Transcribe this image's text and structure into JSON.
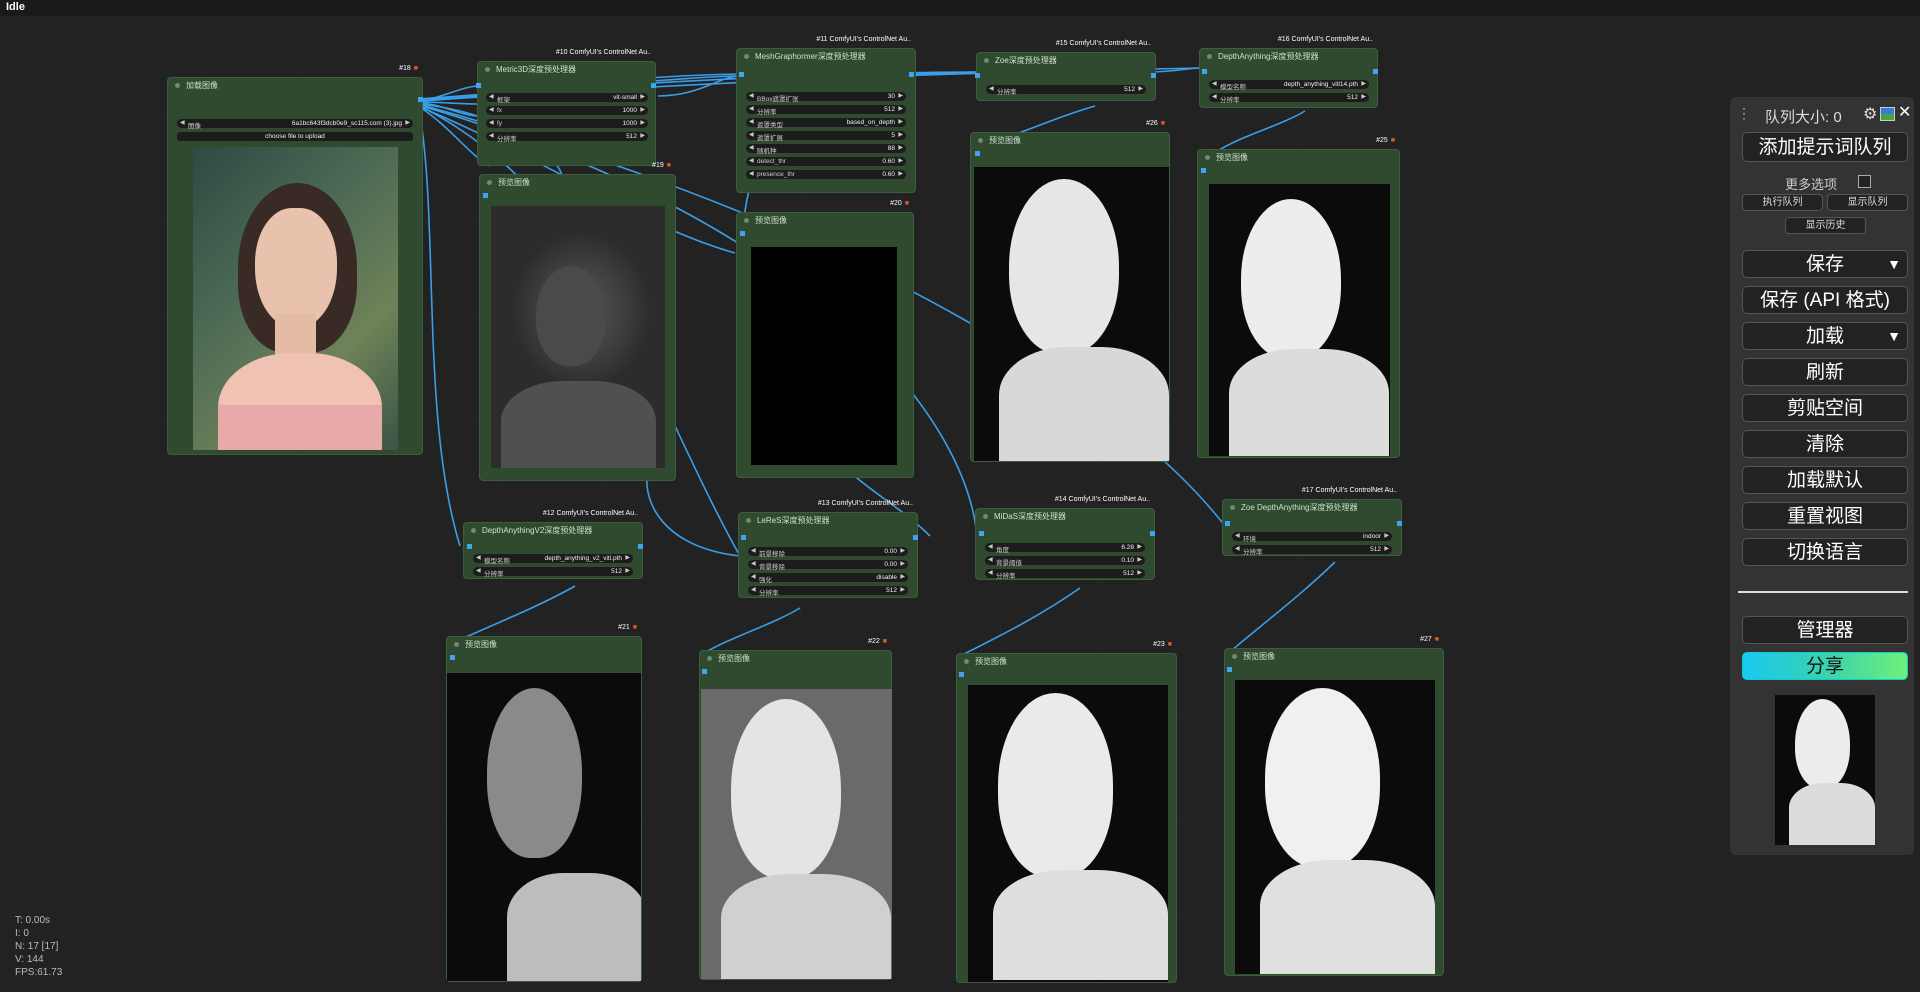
{
  "status": "Idle",
  "queue": {
    "title": "队列大小: 0",
    "add_prompt": "添加提示词队列",
    "more_options": "更多选项",
    "run_queue": "执行队列",
    "show_queue": "显示队列",
    "show_history": "显示历史",
    "save": "保存",
    "save_api": "保存 (API 格式)",
    "load": "加载",
    "refresh": "刷新",
    "clipspace": "剪贴空间",
    "clear": "清除",
    "load_default": "加载默认",
    "reset_view": "重置视图",
    "switch_lang": "切换语言",
    "manager": "管理器",
    "share": "分享"
  },
  "stats": [
    "T: 0.00s",
    "I: 0",
    "N: 17 [17]",
    "V: 144",
    "FPS:61.73"
  ],
  "nodes": {
    "n18": {
      "badge": "#18",
      "title": "加载图像",
      "image_label": "图像",
      "image_value": "6a1bc643f3dcb0e9_sc115.com (3).jpg",
      "upload": "choose file to upload"
    },
    "n10": {
      "badge": "#10 ComfyUI's ControlNet Au..",
      "title": "Metric3D深度预处理器",
      "widgets": [
        {
          "label": "框架",
          "value": "vit-small"
        },
        {
          "label": "fx",
          "value": "1000"
        },
        {
          "label": "fy",
          "value": "1000"
        },
        {
          "label": "分辨率",
          "value": "512"
        }
      ]
    },
    "n11": {
      "badge": "#11 ComfyUI's ControlNet Au..",
      "title": "MeshGraphormer深度预处理器",
      "widgets": [
        {
          "label": "BBox遮罩扩张",
          "value": "30"
        },
        {
          "label": "分辨率",
          "value": "512"
        },
        {
          "label": "遮罩类型",
          "value": "based_on_depth"
        },
        {
          "label": "遮罩扩展",
          "value": "5"
        },
        {
          "label": "随机种",
          "value": "88"
        },
        {
          "label": "detect_thr",
          "value": "0.60"
        },
        {
          "label": "presence_thr",
          "value": "0.60"
        }
      ]
    },
    "n15": {
      "badge": "#15 ComfyUI's ControlNet Au..",
      "title": "Zoe深度预处理器",
      "widgets": [
        {
          "label": "分辨率",
          "value": "512"
        }
      ]
    },
    "n16": {
      "badge": "#16 ComfyUI's ControlNet Au..",
      "title": "DepthAnything深度预处理器",
      "widgets": [
        {
          "label": "模型名称",
          "value": "depth_anything_vitl14.pth"
        },
        {
          "label": "分辨率",
          "value": "512"
        }
      ]
    },
    "n12": {
      "badge": "#12 ComfyUI's ControlNet Au..",
      "title": "DepthAnythingV2深度预处理器",
      "widgets": [
        {
          "label": "模型名称",
          "value": "depth_anything_v2_vitl.pth"
        },
        {
          "label": "分辨率",
          "value": "512"
        }
      ]
    },
    "n13": {
      "badge": "#13 ComfyUI's ControlNet Au..",
      "title": "LeReS深度预处理器",
      "widgets": [
        {
          "label": "前景移除",
          "value": "0.00"
        },
        {
          "label": "背景移除",
          "value": "0.00"
        },
        {
          "label": "强化",
          "value": "disable"
        },
        {
          "label": "分辨率",
          "value": "512"
        }
      ]
    },
    "n14": {
      "badge": "#14 ComfyUI's ControlNet Au..",
      "title": "MiDaS深度预处理器",
      "widgets": [
        {
          "label": "角度",
          "value": "6.28"
        },
        {
          "label": "背景阈值",
          "value": "0.10"
        },
        {
          "label": "分辨率",
          "value": "512"
        }
      ]
    },
    "n17": {
      "badge": "#17 ComfyUI's ControlNet Au..",
      "title": "Zoe DepthAnything深度预处理器",
      "widgets": [
        {
          "label": "环境",
          "value": "indoor"
        },
        {
          "label": "分辨率",
          "value": "512"
        }
      ]
    },
    "n19": {
      "badge": "#19",
      "title": "预览图像"
    },
    "n20": {
      "badge": "#20",
      "title": "预览图像"
    },
    "n26": {
      "badge": "#26",
      "title": "预览图像"
    },
    "n25": {
      "badge": "#25",
      "title": "预览图像"
    },
    "n21": {
      "badge": "#21",
      "title": "预览图像"
    },
    "n22": {
      "badge": "#22",
      "title": "预览图像"
    },
    "n23": {
      "badge": "#23",
      "title": "预览图像"
    },
    "n27": {
      "badge": "#27",
      "title": "预览图像"
    }
  }
}
